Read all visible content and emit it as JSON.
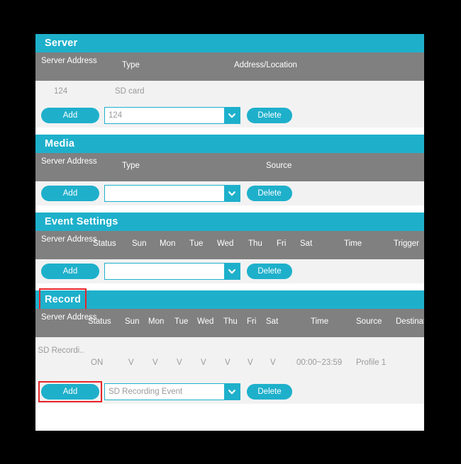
{
  "colors": {
    "accent": "#1eb0cb",
    "header_row": "#808080",
    "row_bg": "#f2f2f2",
    "link": "#3a63c8",
    "muted_text": "#9a9a9a",
    "highlight": "#e8252a"
  },
  "sections": [
    {
      "title": "Server",
      "highlighted": false,
      "columns": [
        "Server Address",
        "Type",
        "Address/Location"
      ],
      "rows": [
        {
          "address": "124",
          "type": "SD card",
          "location": ""
        }
      ],
      "controls": {
        "add_label": "Add",
        "delete_label": "Delete",
        "select_value": "124",
        "add_highlighted": false
      }
    },
    {
      "title": "Media",
      "highlighted": false,
      "columns": [
        "Server Address",
        "Type",
        "Source"
      ],
      "rows": [],
      "controls": {
        "add_label": "Add",
        "delete_label": "Delete",
        "select_value": "",
        "add_highlighted": false
      }
    },
    {
      "title": "Event Settings",
      "highlighted": false,
      "columns": [
        "Server Address",
        "Status",
        "Sun",
        "Mon",
        "Tue",
        "Wed",
        "Thu",
        "Fri",
        "Sat",
        "Time",
        "Trigger"
      ],
      "rows": [],
      "controls": {
        "add_label": "Add",
        "delete_label": "Delete",
        "select_value": "",
        "add_highlighted": false
      }
    },
    {
      "title": "Record",
      "highlighted": true,
      "columns": [
        "Server Address",
        "Status",
        "Sun",
        "Mon",
        "Tue",
        "Wed",
        "Thu",
        "Fri",
        "Sat",
        "Time",
        "Source",
        "Destination"
      ],
      "rows": [
        {
          "address": "SD Recordi..",
          "status": "ON",
          "days": [
            "V",
            "V",
            "V",
            "V",
            "V",
            "V",
            "V"
          ],
          "time": "00:00~23:59",
          "source": "Profile 1",
          "destination": ""
        }
      ],
      "controls": {
        "add_label": "Add",
        "delete_label": "Delete",
        "select_value": "SD Recording Event",
        "add_highlighted": true
      }
    }
  ],
  "icons": {
    "dropdown": "chevron-down-icon"
  }
}
